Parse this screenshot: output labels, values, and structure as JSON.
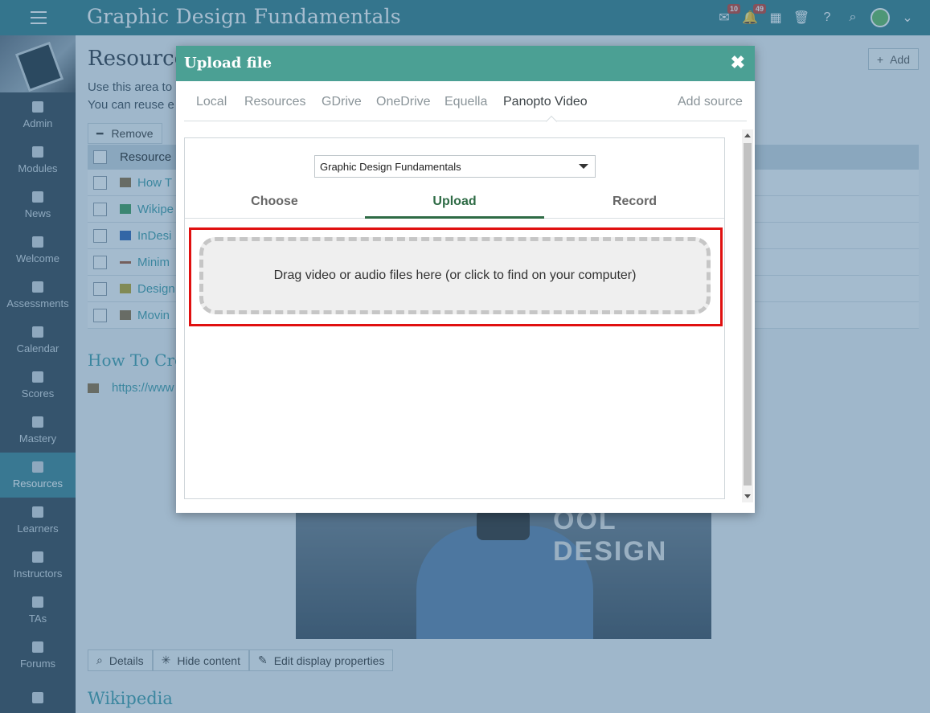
{
  "header": {
    "course_title": "Graphic Design Fundamentals",
    "messages_badge": "10",
    "notifications_badge": "49"
  },
  "sidebar": {
    "items": [
      {
        "label": "Admin",
        "icon": "gear-icon"
      },
      {
        "label": "Modules",
        "icon": "book-icon"
      },
      {
        "label": "News",
        "icon": "newspaper-icon"
      },
      {
        "label": "Welcome",
        "icon": "sparkle-icon"
      },
      {
        "label": "Assessments",
        "icon": "checkbox-icon"
      },
      {
        "label": "Calendar",
        "icon": "calendar-icon"
      },
      {
        "label": "Scores",
        "icon": "scores-icon"
      },
      {
        "label": "Mastery",
        "icon": "bar-chart-icon"
      },
      {
        "label": "Resources",
        "icon": "library-icon",
        "active": true
      },
      {
        "label": "Learners",
        "icon": "person-icon"
      },
      {
        "label": "Instructors",
        "icon": "person-icon"
      },
      {
        "label": "TAs",
        "icon": "person-icon"
      },
      {
        "label": "Forums",
        "icon": "list-icon"
      },
      {
        "label": "",
        "icon": "trophy-icon"
      }
    ]
  },
  "main": {
    "page_title": "Resource",
    "description_line1": "Use this area to",
    "description_line2": "You can reuse e",
    "add_label": "Add",
    "remove_label": "Remove",
    "table_header": "Resource",
    "rows": [
      "How T",
      "Wikipe",
      "InDesi",
      "Minim",
      "Design",
      "Movin"
    ],
    "section_heading": "How To Cre",
    "section_link": "https://www",
    "video_overlay_text": "OOL DESIGN",
    "buttons": {
      "details": "Details",
      "hide_content": "Hide content",
      "edit_display": "Edit display properties"
    },
    "wiki_heading": "Wikipedia"
  },
  "modal": {
    "title": "Upload file",
    "close_glyph": "✖",
    "source_tabs": [
      "Local",
      "Resources",
      "GDrive",
      "OneDrive",
      "Equella",
      "Panopto Video"
    ],
    "active_source": "Panopto Video",
    "add_source": "Add source",
    "folder_select": "Graphic Design Fundamentals",
    "sub_tabs": [
      "Choose",
      "Upload",
      "Record"
    ],
    "active_sub_tab": "Upload",
    "dropzone_text": "Drag video or audio files here (or click to find on your computer)"
  },
  "colors": {
    "topbar": "#2c7a86",
    "modal_header": "#4ba094",
    "active_tab": "#2e6b45",
    "highlight": "#e01010"
  }
}
